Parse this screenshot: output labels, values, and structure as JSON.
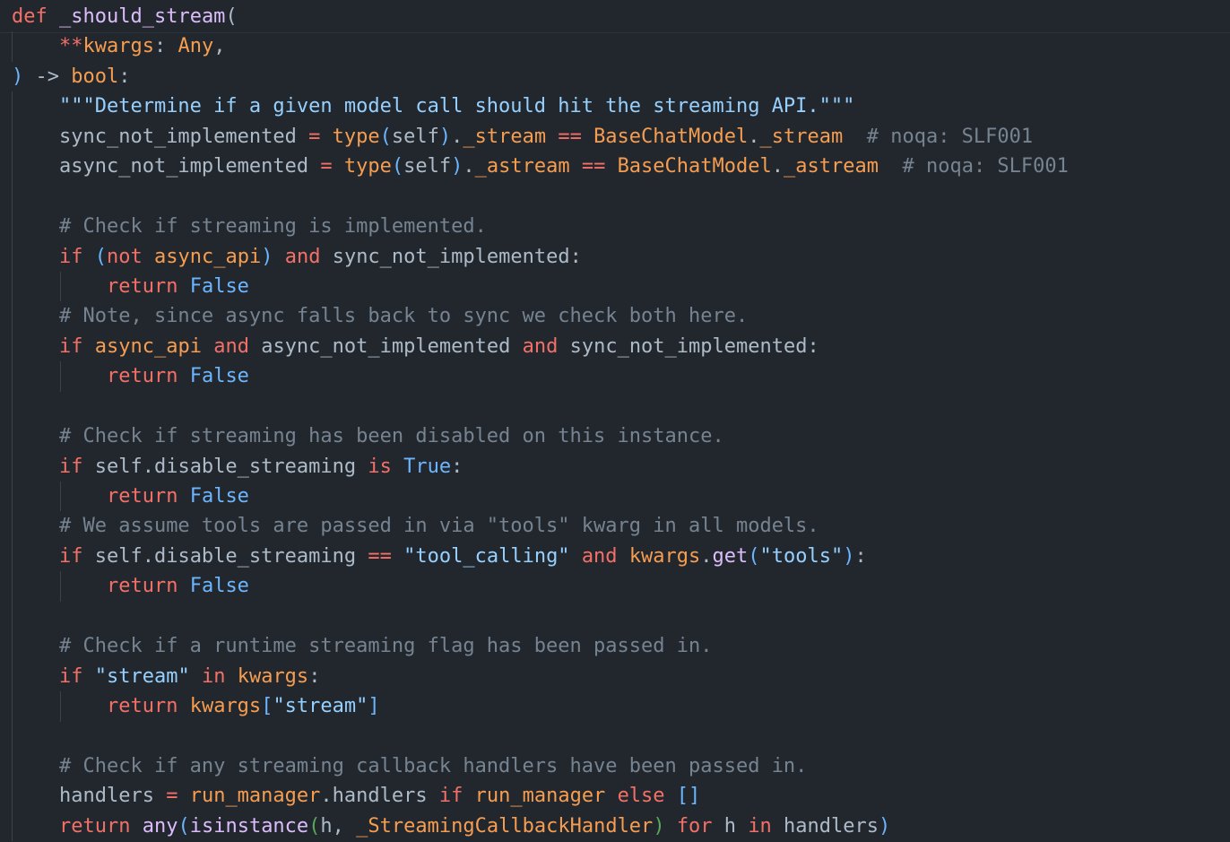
{
  "editor": {
    "language": "python",
    "theme_colors": {
      "background": "#22272e",
      "keyword": "#f47067",
      "builtin": "#f69d50",
      "constant": "#6cb6ff",
      "string": "#96d0ff",
      "comment": "#768390",
      "plain": "#adbac7",
      "function": "#dcbdfb",
      "bracket_level2": "#57ab5a"
    },
    "lines": [
      {
        "guides": [],
        "tokens": [
          {
            "t": "def",
            "c": "kw"
          },
          {
            "t": " ",
            "c": "pl"
          },
          {
            "t": "_should_stream",
            "c": "fn"
          },
          {
            "t": "(",
            "c": "pl"
          }
        ]
      },
      {
        "guides": [
          0
        ],
        "tokens": [
          {
            "t": "    ",
            "c": "pl"
          },
          {
            "t": "**",
            "c": "op"
          },
          {
            "t": "kwargs",
            "c": "var"
          },
          {
            "t": ": ",
            "c": "pl"
          },
          {
            "t": "Any",
            "c": "cls"
          },
          {
            "t": ",",
            "c": "pl"
          }
        ]
      },
      {
        "guides": [],
        "tokens": [
          {
            "t": ")",
            "c": "p1"
          },
          {
            "t": " -> ",
            "c": "pl"
          },
          {
            "t": "bool",
            "c": "blt"
          },
          {
            "t": ":",
            "c": "pl"
          }
        ]
      },
      {
        "guides": [
          0
        ],
        "tokens": [
          {
            "t": "    ",
            "c": "pl"
          },
          {
            "t": "\"\"\"Determine if a given model call should hit the streaming API.\"\"\"",
            "c": "str"
          }
        ]
      },
      {
        "guides": [
          0
        ],
        "tokens": [
          {
            "t": "    ",
            "c": "pl"
          },
          {
            "t": "sync_not_implemented",
            "c": "pl"
          },
          {
            "t": " = ",
            "c": "op"
          },
          {
            "t": "type",
            "c": "blt"
          },
          {
            "t": "(",
            "c": "p1"
          },
          {
            "t": "self",
            "c": "pl"
          },
          {
            "t": ")",
            "c": "p1"
          },
          {
            "t": ".",
            "c": "pl"
          },
          {
            "t": "_stream",
            "c": "var"
          },
          {
            "t": " == ",
            "c": "op"
          },
          {
            "t": "BaseChatModel",
            "c": "cls"
          },
          {
            "t": ".",
            "c": "pl"
          },
          {
            "t": "_stream",
            "c": "var"
          },
          {
            "t": "  ",
            "c": "pl"
          },
          {
            "t": "# noqa: SLF001",
            "c": "cm"
          }
        ]
      },
      {
        "guides": [
          0
        ],
        "tokens": [
          {
            "t": "    ",
            "c": "pl"
          },
          {
            "t": "async_not_implemented",
            "c": "pl"
          },
          {
            "t": " = ",
            "c": "op"
          },
          {
            "t": "type",
            "c": "blt"
          },
          {
            "t": "(",
            "c": "p1"
          },
          {
            "t": "self",
            "c": "pl"
          },
          {
            "t": ")",
            "c": "p1"
          },
          {
            "t": ".",
            "c": "pl"
          },
          {
            "t": "_astream",
            "c": "var"
          },
          {
            "t": " == ",
            "c": "op"
          },
          {
            "t": "BaseChatModel",
            "c": "cls"
          },
          {
            "t": ".",
            "c": "pl"
          },
          {
            "t": "_astream",
            "c": "var"
          },
          {
            "t": "  ",
            "c": "pl"
          },
          {
            "t": "# noqa: SLF001",
            "c": "cm"
          }
        ]
      },
      {
        "guides": [
          0
        ],
        "tokens": []
      },
      {
        "guides": [
          0
        ],
        "tokens": [
          {
            "t": "    ",
            "c": "pl"
          },
          {
            "t": "# Check if streaming is implemented.",
            "c": "cm"
          }
        ]
      },
      {
        "guides": [
          0
        ],
        "tokens": [
          {
            "t": "    ",
            "c": "pl"
          },
          {
            "t": "if",
            "c": "kw"
          },
          {
            "t": " ",
            "c": "pl"
          },
          {
            "t": "(",
            "c": "p1"
          },
          {
            "t": "not",
            "c": "kw"
          },
          {
            "t": " ",
            "c": "pl"
          },
          {
            "t": "async_api",
            "c": "var"
          },
          {
            "t": ")",
            "c": "p1"
          },
          {
            "t": " ",
            "c": "pl"
          },
          {
            "t": "and",
            "c": "kw"
          },
          {
            "t": " sync_not_implemented:",
            "c": "pl"
          }
        ]
      },
      {
        "guides": [
          0,
          1
        ],
        "tokens": [
          {
            "t": "        ",
            "c": "pl"
          },
          {
            "t": "return",
            "c": "kw"
          },
          {
            "t": " ",
            "c": "pl"
          },
          {
            "t": "False",
            "c": "const"
          }
        ]
      },
      {
        "guides": [
          0
        ],
        "tokens": [
          {
            "t": "    ",
            "c": "pl"
          },
          {
            "t": "# Note, since async falls back to sync we check both here.",
            "c": "cm"
          }
        ]
      },
      {
        "guides": [
          0
        ],
        "tokens": [
          {
            "t": "    ",
            "c": "pl"
          },
          {
            "t": "if",
            "c": "kw"
          },
          {
            "t": " ",
            "c": "pl"
          },
          {
            "t": "async_api",
            "c": "var"
          },
          {
            "t": " ",
            "c": "pl"
          },
          {
            "t": "and",
            "c": "kw"
          },
          {
            "t": " async_not_implemented ",
            "c": "pl"
          },
          {
            "t": "and",
            "c": "kw"
          },
          {
            "t": " sync_not_implemented:",
            "c": "pl"
          }
        ]
      },
      {
        "guides": [
          0,
          1
        ],
        "tokens": [
          {
            "t": "        ",
            "c": "pl"
          },
          {
            "t": "return",
            "c": "kw"
          },
          {
            "t": " ",
            "c": "pl"
          },
          {
            "t": "False",
            "c": "const"
          }
        ]
      },
      {
        "guides": [
          0
        ],
        "tokens": []
      },
      {
        "guides": [
          0
        ],
        "tokens": [
          {
            "t": "    ",
            "c": "pl"
          },
          {
            "t": "# Check if streaming has been disabled on this instance.",
            "c": "cm"
          }
        ]
      },
      {
        "guides": [
          0
        ],
        "tokens": [
          {
            "t": "    ",
            "c": "pl"
          },
          {
            "t": "if",
            "c": "kw"
          },
          {
            "t": " self.disable_streaming ",
            "c": "pl"
          },
          {
            "t": "is",
            "c": "kw"
          },
          {
            "t": " ",
            "c": "pl"
          },
          {
            "t": "True",
            "c": "const"
          },
          {
            "t": ":",
            "c": "pl"
          }
        ]
      },
      {
        "guides": [
          0,
          1
        ],
        "tokens": [
          {
            "t": "        ",
            "c": "pl"
          },
          {
            "t": "return",
            "c": "kw"
          },
          {
            "t": " ",
            "c": "pl"
          },
          {
            "t": "False",
            "c": "const"
          }
        ]
      },
      {
        "guides": [
          0
        ],
        "tokens": [
          {
            "t": "    ",
            "c": "pl"
          },
          {
            "t": "# We assume tools are passed in via \"tools\" kwarg in all models.",
            "c": "cm"
          }
        ]
      },
      {
        "guides": [
          0
        ],
        "tokens": [
          {
            "t": "    ",
            "c": "pl"
          },
          {
            "t": "if",
            "c": "kw"
          },
          {
            "t": " self.disable_streaming ",
            "c": "pl"
          },
          {
            "t": "==",
            "c": "op"
          },
          {
            "t": " ",
            "c": "pl"
          },
          {
            "t": "\"tool_calling\"",
            "c": "str"
          },
          {
            "t": " ",
            "c": "pl"
          },
          {
            "t": "and",
            "c": "kw"
          },
          {
            "t": " ",
            "c": "pl"
          },
          {
            "t": "kwargs",
            "c": "var"
          },
          {
            "t": ".",
            "c": "pl"
          },
          {
            "t": "get",
            "c": "fn"
          },
          {
            "t": "(",
            "c": "p1"
          },
          {
            "t": "\"tools\"",
            "c": "str"
          },
          {
            "t": ")",
            "c": "p1"
          },
          {
            "t": ":",
            "c": "pl"
          }
        ]
      },
      {
        "guides": [
          0,
          1
        ],
        "tokens": [
          {
            "t": "        ",
            "c": "pl"
          },
          {
            "t": "return",
            "c": "kw"
          },
          {
            "t": " ",
            "c": "pl"
          },
          {
            "t": "False",
            "c": "const"
          }
        ]
      },
      {
        "guides": [
          0
        ],
        "tokens": []
      },
      {
        "guides": [
          0
        ],
        "tokens": [
          {
            "t": "    ",
            "c": "pl"
          },
          {
            "t": "# Check if a runtime streaming flag has been passed in.",
            "c": "cm"
          }
        ]
      },
      {
        "guides": [
          0
        ],
        "tokens": [
          {
            "t": "    ",
            "c": "pl"
          },
          {
            "t": "if",
            "c": "kw"
          },
          {
            "t": " ",
            "c": "pl"
          },
          {
            "t": "\"stream\"",
            "c": "str"
          },
          {
            "t": " ",
            "c": "pl"
          },
          {
            "t": "in",
            "c": "kw"
          },
          {
            "t": " ",
            "c": "pl"
          },
          {
            "t": "kwargs",
            "c": "var"
          },
          {
            "t": ":",
            "c": "pl"
          }
        ]
      },
      {
        "guides": [
          0,
          1
        ],
        "tokens": [
          {
            "t": "        ",
            "c": "pl"
          },
          {
            "t": "return",
            "c": "kw"
          },
          {
            "t": " ",
            "c": "pl"
          },
          {
            "t": "kwargs",
            "c": "var"
          },
          {
            "t": "[",
            "c": "p1"
          },
          {
            "t": "\"stream\"",
            "c": "str"
          },
          {
            "t": "]",
            "c": "p1"
          }
        ]
      },
      {
        "guides": [
          0
        ],
        "tokens": []
      },
      {
        "guides": [
          0
        ],
        "tokens": [
          {
            "t": "    ",
            "c": "pl"
          },
          {
            "t": "# Check if any streaming callback handlers have been passed in.",
            "c": "cm"
          }
        ]
      },
      {
        "guides": [
          0
        ],
        "tokens": [
          {
            "t": "    ",
            "c": "pl"
          },
          {
            "t": "handlers",
            "c": "pl"
          },
          {
            "t": " = ",
            "c": "op"
          },
          {
            "t": "run_manager",
            "c": "var"
          },
          {
            "t": ".handlers ",
            "c": "pl"
          },
          {
            "t": "if",
            "c": "kw"
          },
          {
            "t": " ",
            "c": "pl"
          },
          {
            "t": "run_manager",
            "c": "var"
          },
          {
            "t": " ",
            "c": "pl"
          },
          {
            "t": "else",
            "c": "kw"
          },
          {
            "t": " ",
            "c": "pl"
          },
          {
            "t": "[]",
            "c": "p1"
          }
        ]
      },
      {
        "guides": [
          0
        ],
        "tokens": [
          {
            "t": "    ",
            "c": "pl"
          },
          {
            "t": "return",
            "c": "kw"
          },
          {
            "t": " ",
            "c": "pl"
          },
          {
            "t": "any",
            "c": "fn"
          },
          {
            "t": "(",
            "c": "p1"
          },
          {
            "t": "isinstance",
            "c": "fn"
          },
          {
            "t": "(",
            "c": "p2"
          },
          {
            "t": "h, ",
            "c": "pl"
          },
          {
            "t": "_StreamingCallbackHandler",
            "c": "cls"
          },
          {
            "t": ")",
            "c": "p2"
          },
          {
            "t": " ",
            "c": "pl"
          },
          {
            "t": "for",
            "c": "kw"
          },
          {
            "t": " h ",
            "c": "pl"
          },
          {
            "t": "in",
            "c": "kw"
          },
          {
            "t": " handlers",
            "c": "pl"
          },
          {
            "t": ")",
            "c": "p1"
          }
        ]
      }
    ]
  }
}
